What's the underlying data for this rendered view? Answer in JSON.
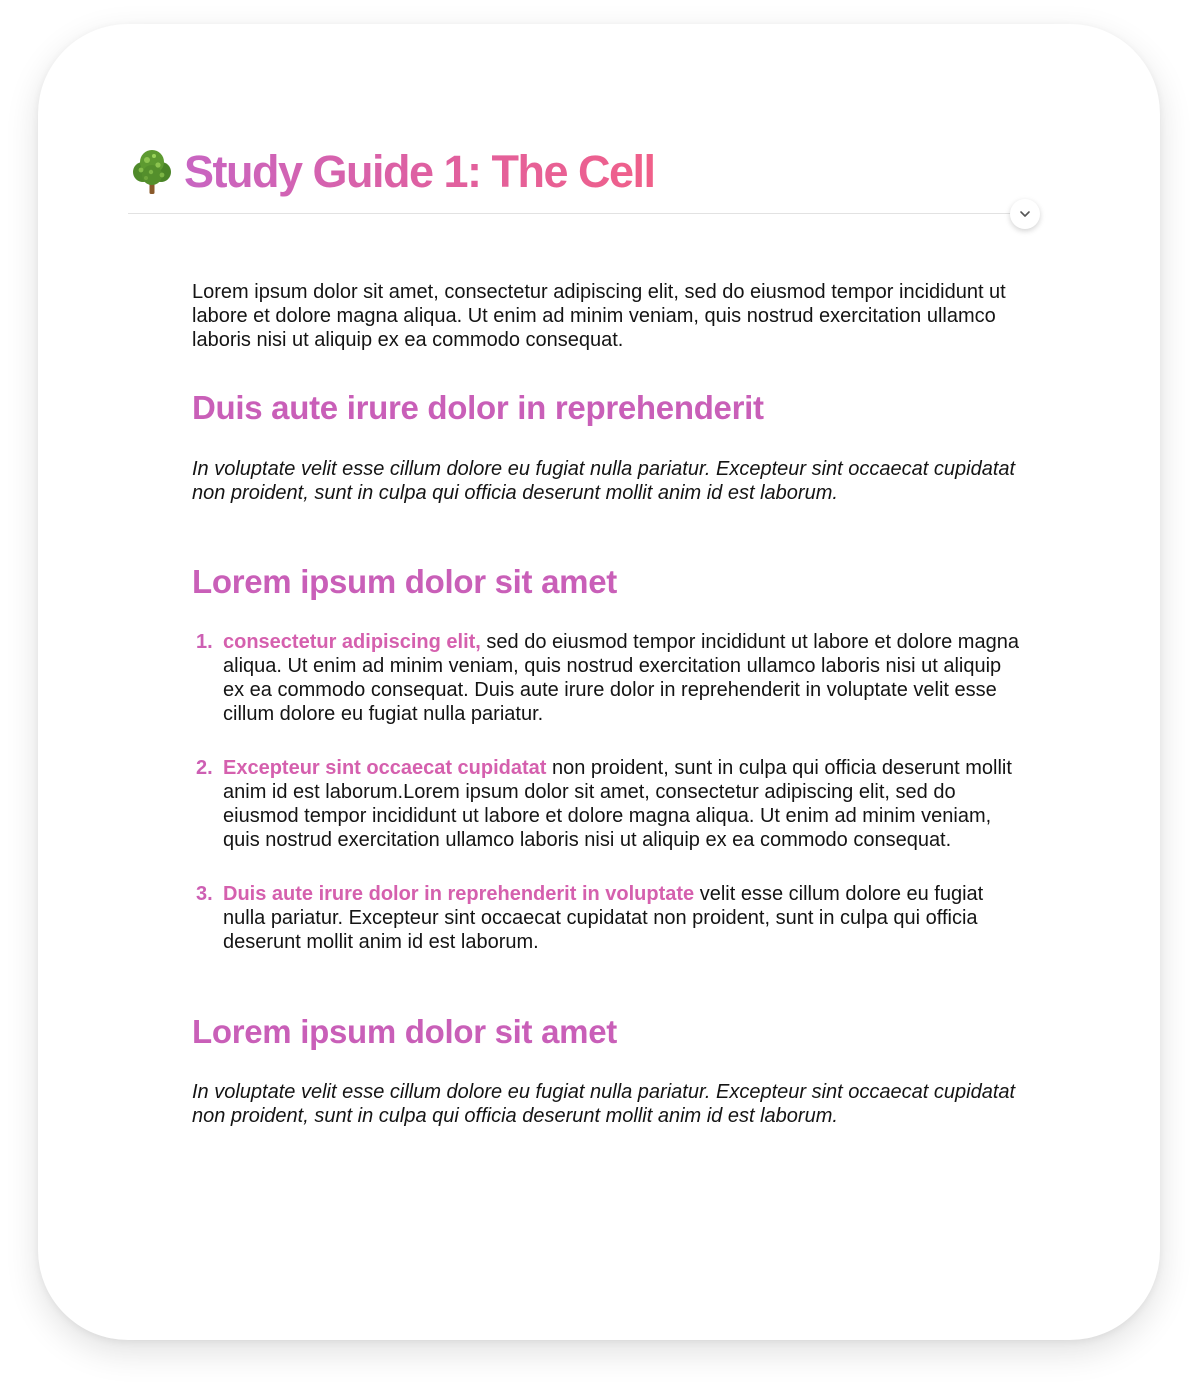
{
  "header": {
    "emoji": "tree-icon",
    "title": "Study Guide 1: The Cell"
  },
  "intro": "Lorem ipsum dolor sit amet, consectetur adipiscing elit, sed do eiusmod tempor incididunt ut labore et dolore magna aliqua. Ut enim ad minim veniam, quis nostrud exercitation ullamco laboris nisi ut aliquip ex ea commodo consequat.",
  "sections": [
    {
      "heading": "Duis aute irure dolor in reprehenderit",
      "body": "In voluptate velit esse cillum dolore eu fugiat nulla pariatur. Excepteur sint occaecat cupidatat non proident, sunt in culpa qui officia deserunt mollit anim id est laborum."
    },
    {
      "heading": "Lorem ipsum dolor sit amet",
      "list": [
        {
          "number": "1.",
          "lead": "consectetur adipiscing elit,",
          "text": " sed do eiusmod tempor incididunt ut labore et dolore magna aliqua. Ut enim ad minim veniam, quis nostrud exercitation ullamco laboris nisi ut aliquip ex ea commodo consequat. Duis aute irure dolor in reprehenderit in voluptate velit esse cillum dolore eu fugiat nulla pariatur."
        },
        {
          "number": "2.",
          "lead": "Excepteur sint occaecat cupidatat",
          "text": " non proident, sunt in culpa qui officia deserunt mollit anim id est laborum.Lorem ipsum dolor sit amet, consectetur adipiscing elit, sed do eiusmod tempor incididunt ut labore et dolore magna aliqua. Ut enim ad minim veniam, quis nostrud exercitation ullamco laboris nisi ut aliquip ex ea commodo consequat."
        },
        {
          "number": "3.",
          "lead": "Duis aute irure dolor in reprehenderit in voluptate",
          "text": " velit esse cillum dolore eu fugiat nulla pariatur. Excepteur sint occaecat cupidatat non proident, sunt in culpa qui officia deserunt mollit anim id est laborum."
        }
      ]
    },
    {
      "heading": "Lorem ipsum dolor sit amet",
      "body": "In voluptate velit esse cillum dolore eu fugiat nulla pariatur. Excepteur sint occaecat cupidatat non proident, sunt in culpa qui officia deserunt mollit anim id est laborum."
    }
  ],
  "controls": {
    "collapse_icon": "chevron-down-icon"
  },
  "colors": {
    "heading": "#c95fb8",
    "title_gradient_start": "#c865c2",
    "title_gradient_end": "#f0608a",
    "list_lead": "#d560ae",
    "body_text": "#141414"
  }
}
